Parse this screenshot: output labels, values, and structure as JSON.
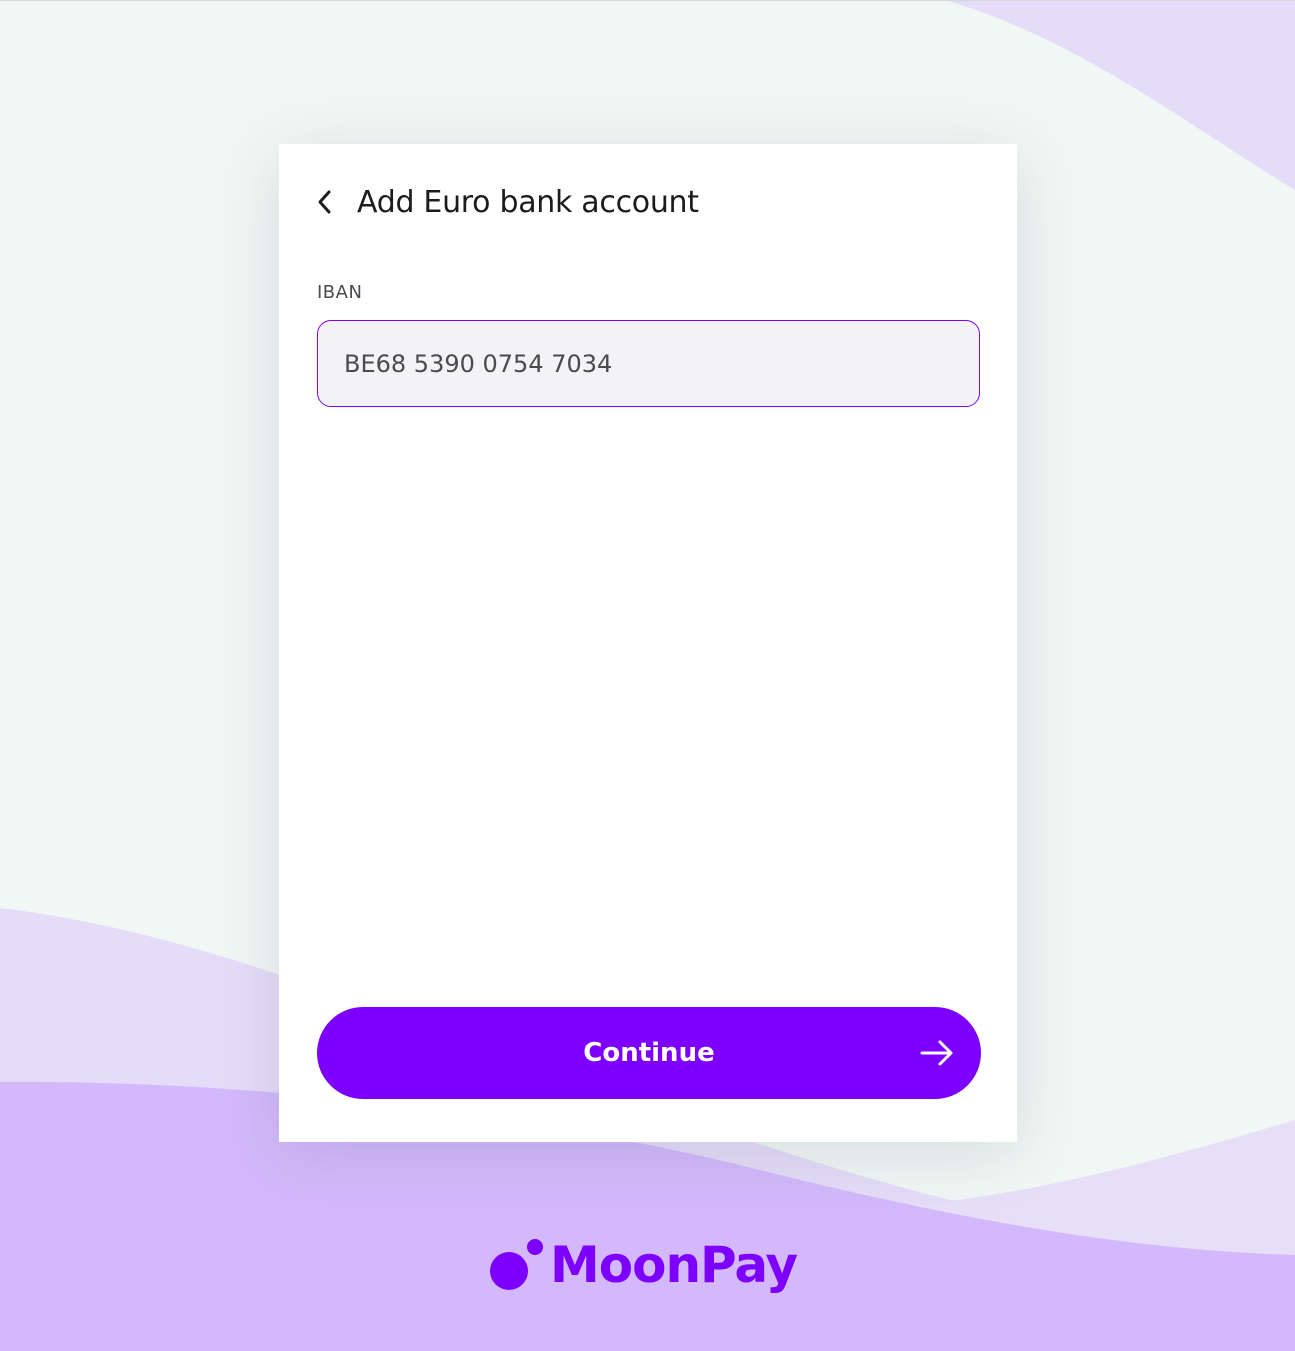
{
  "header": {
    "title": "Add Euro bank account",
    "back_icon": "chevron-left-icon"
  },
  "form": {
    "iban_label": "IBAN",
    "iban_value": "BE68 5390 0754 7034"
  },
  "actions": {
    "continue_label": "Continue",
    "continue_icon": "arrow-right-icon"
  },
  "brand": {
    "name": "MoonPay",
    "logo_icon": "moonpay-logo-icon"
  },
  "colors": {
    "accent": "#7d00ff",
    "background": "#f0f7f5",
    "wave_light": "#e4dcf8",
    "wave_mid": "#d3b9fb",
    "input_bg": "#f3f3f5"
  }
}
